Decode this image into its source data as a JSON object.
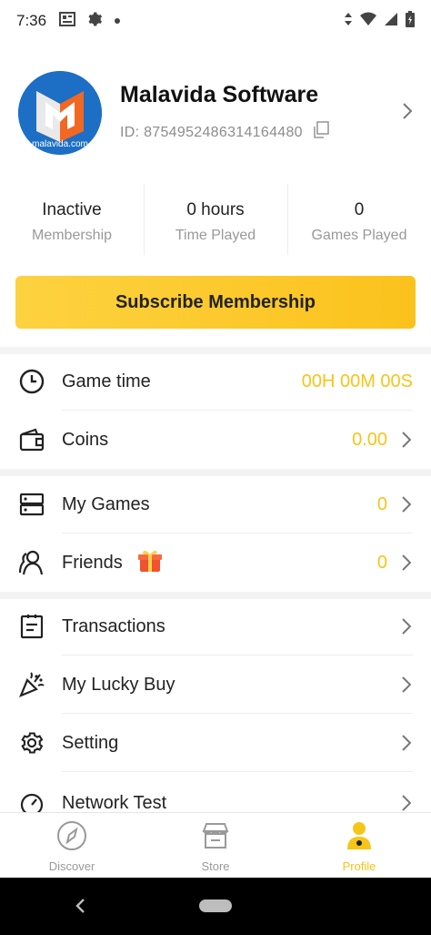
{
  "status_bar": {
    "time": "7:36"
  },
  "profile": {
    "avatar_text": "malavida.com",
    "name": "Malavida Software",
    "id": "ID: 8754952486314164480"
  },
  "stats": [
    {
      "value": "Inactive",
      "label": "Membership"
    },
    {
      "value": "0 hours",
      "label": "Time Played"
    },
    {
      "value": "0",
      "label": "Games Played"
    }
  ],
  "subscribe_label": "Subscribe Membership",
  "menu": {
    "game_time": {
      "label": "Game time",
      "value": "00H 00M 00S"
    },
    "coins": {
      "label": "Coins",
      "value": "0.00"
    },
    "my_games": {
      "label": "My Games",
      "value": "0"
    },
    "friends": {
      "label": "Friends",
      "value": "0"
    },
    "transactions": {
      "label": "Transactions"
    },
    "lucky_buy": {
      "label": "My Lucky Buy"
    },
    "setting": {
      "label": "Setting"
    },
    "network_test": {
      "label": "Network Test"
    }
  },
  "bottom_nav": [
    {
      "label": "Discover",
      "icon": "compass-icon"
    },
    {
      "label": "Store",
      "icon": "store-icon"
    },
    {
      "label": "Profile",
      "icon": "profile-icon",
      "active": true
    }
  ],
  "colors": {
    "accent": "#f5c518",
    "button_gradient_start": "#fdd240",
    "button_gradient_end": "#fbc21c"
  }
}
